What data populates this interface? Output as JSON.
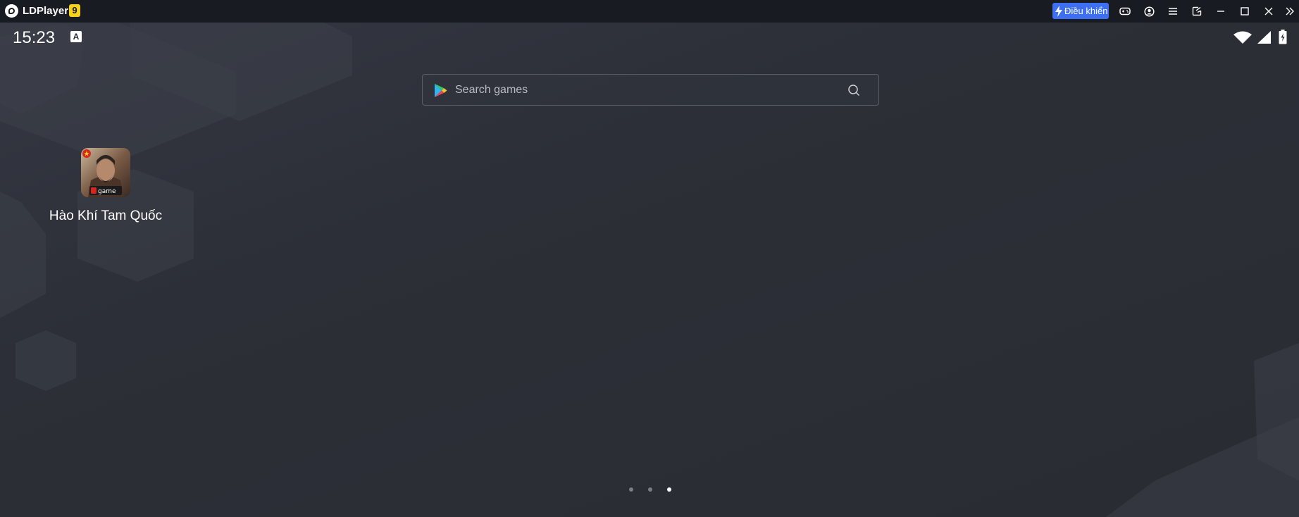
{
  "titlebar": {
    "app_name": "LDPlayer",
    "version_badge": "9",
    "control_button_label": "Điều khiển",
    "icons": [
      "gamepad-icon",
      "account-icon",
      "menu-icon",
      "screen-capture-icon",
      "minimize-icon",
      "maximize-icon",
      "close-icon",
      "expand-sidebar-icon"
    ],
    "accent_color": "#3d6ff0",
    "badge_color": "#f5d21c"
  },
  "statusbar": {
    "time": "15:23",
    "notification_icon": "A",
    "right_icons": [
      "wifi-icon",
      "signal-icon",
      "battery-charging-icon"
    ]
  },
  "search": {
    "placeholder": "Search games"
  },
  "desktop": {
    "apps": [
      {
        "label": "Hào Khí Tam Quốc",
        "badge": "game",
        "icon": "hao-khi-tam-quoc-icon"
      }
    ]
  },
  "pager": {
    "pages": 3,
    "current_page": 3
  }
}
